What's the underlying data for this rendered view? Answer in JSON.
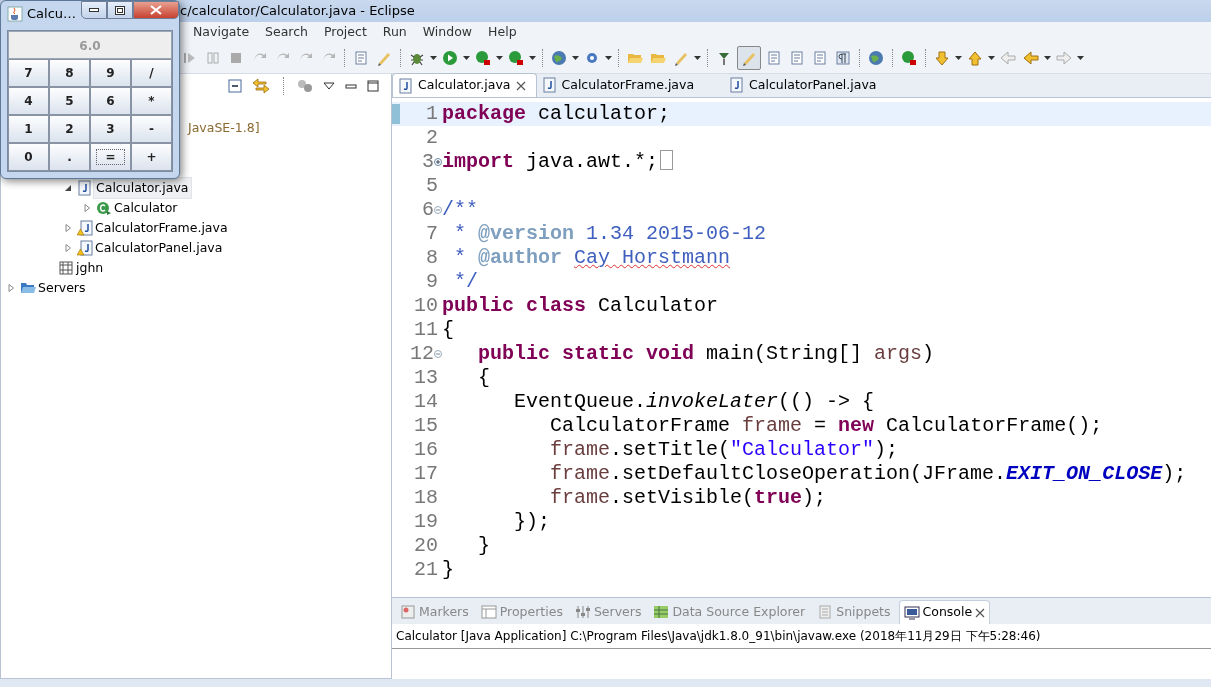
{
  "window": {
    "title": "c/calculator/Calculator.java - Eclipse"
  },
  "menu": [
    "Navigate",
    "Search",
    "Project",
    "Run",
    "Window",
    "Help"
  ],
  "tree": [
    {
      "children": [
        {
          "label": "JavaSE-1.8]",
          "kind": "library-tail"
        },
        {
          "children": [
            {
              "children": [
                {
                  "label": "Calculator.java",
                  "kind": "java",
                  "expanded": true,
                  "selected": true,
                  "children": [
                    {
                      "label": "Calculator",
                      "kind": "class",
                      "expanded": false,
                      "selected": false
                    }
                  ]
                },
                {
                  "label": "CalculatorFrame.java",
                  "kind": "java-warning",
                  "expanded": false,
                  "selected": false
                },
                {
                  "label": "CalculatorPanel.java",
                  "kind": "java-warning",
                  "expanded": false,
                  "selected": false
                }
              ]
            },
            {
              "label": "jghn",
              "kind": "package",
              "selected": false
            }
          ]
        }
      ]
    },
    {
      "label": "Servers",
      "kind": "folder",
      "expanded": false,
      "selected": false
    }
  ],
  "editor_tabs": [
    {
      "label": "Calculator.java",
      "selected": true
    },
    {
      "label": "CalculatorFrame.java",
      "selected": false
    },
    {
      "label": "CalculatorPanel.java",
      "selected": false
    }
  ],
  "code": [
    {
      "number": "1",
      "current": true,
      "tokens": [
        {
          "kind": "keyword",
          "text": "package"
        },
        {
          "kind": "plain",
          "text": " calculator;"
        }
      ]
    },
    {
      "number": "2"
    },
    {
      "number": "3",
      "folded": true,
      "folded_marker": true,
      "tokens": [
        {
          "kind": "keyword",
          "text": "import"
        },
        {
          "kind": "plain",
          "text": " java.awt.*;"
        }
      ]
    },
    {
      "number": "5"
    },
    {
      "number": "6",
      "folded": false,
      "tokens": [
        {
          "kind": "doc",
          "text": "/**"
        }
      ]
    },
    {
      "number": "7",
      "tokens": [
        {
          "kind": "doc",
          "text": " * "
        },
        {
          "kind": "doctag",
          "text": "@version"
        },
        {
          "kind": "doc",
          "text": " 1.34 2015-06-12"
        }
      ]
    },
    {
      "number": "8",
      "tokens": [
        {
          "kind": "doc",
          "text": " * "
        },
        {
          "kind": "doctag",
          "text": "@author "
        },
        {
          "kind": "doc-misspelled",
          "text": "Cay Horstmann"
        }
      ]
    },
    {
      "number": "9",
      "tokens": [
        {
          "kind": "doc",
          "text": " */"
        }
      ]
    },
    {
      "number": "10",
      "tokens": [
        {
          "kind": "keyword",
          "text": "public class"
        },
        {
          "kind": "plain",
          "text": " Calculator"
        }
      ]
    },
    {
      "number": "11",
      "tokens": [
        {
          "kind": "plain",
          "text": "{"
        }
      ]
    },
    {
      "number": "12",
      "folded": false,
      "tokens": [
        {
          "kind": "keyword",
          "text": "   public static void"
        },
        {
          "kind": "plain",
          "text": " main(String[] "
        },
        {
          "kind": "variable",
          "text": "args"
        },
        {
          "kind": "plain",
          "text": ")"
        }
      ]
    },
    {
      "number": "13",
      "tokens": [
        {
          "kind": "plain",
          "text": "   {"
        }
      ]
    },
    {
      "number": "14",
      "tokens": [
        {
          "kind": "plain",
          "text": "      EventQueue."
        },
        {
          "kind": "static-method",
          "text": "invokeLater"
        },
        {
          "kind": "plain",
          "text": "(() -> {"
        }
      ]
    },
    {
      "number": "15",
      "tokens": [
        {
          "kind": "plain",
          "text": "         CalculatorFrame "
        },
        {
          "kind": "variable",
          "text": "frame"
        },
        {
          "kind": "plain",
          "text": " = "
        },
        {
          "kind": "keyword",
          "text": "new"
        },
        {
          "kind": "plain",
          "text": " CalculatorFrame();"
        }
      ]
    },
    {
      "number": "16",
      "tokens": [
        {
          "kind": "variable",
          "text": "         frame"
        },
        {
          "kind": "plain",
          "text": ".setTitle("
        },
        {
          "kind": "string",
          "text": "\"Calculator\""
        },
        {
          "kind": "plain",
          "text": ");"
        }
      ]
    },
    {
      "number": "17",
      "tokens": [
        {
          "kind": "variable",
          "text": "         frame"
        },
        {
          "kind": "plain",
          "text": ".setDefaultCloseOperation(JFrame."
        },
        {
          "kind": "static-field",
          "text": "EXIT_ON_CLOSE"
        },
        {
          "kind": "plain",
          "text": ");"
        }
      ]
    },
    {
      "number": "18",
      "tokens": [
        {
          "kind": "variable",
          "text": "         frame"
        },
        {
          "kind": "plain",
          "text": ".setVisible("
        },
        {
          "kind": "keyword",
          "text": "true"
        },
        {
          "kind": "plain",
          "text": ");"
        }
      ]
    },
    {
      "number": "19",
      "tokens": [
        {
          "kind": "plain",
          "text": "      });"
        }
      ]
    },
    {
      "number": "20",
      "tokens": [
        {
          "kind": "plain",
          "text": "   }"
        }
      ]
    },
    {
      "number": "21",
      "tokens": [
        {
          "kind": "plain",
          "text": "}"
        }
      ]
    }
  ],
  "bottom_tabs": [
    {
      "label": "Markers",
      "selected": false
    },
    {
      "label": "Properties",
      "selected": false
    },
    {
      "label": "Servers",
      "selected": false
    },
    {
      "label": "Data Source Explorer",
      "selected": false
    },
    {
      "label": "Snippets",
      "selected": false
    },
    {
      "label": "Console",
      "selected": true
    }
  ],
  "console": {
    "header": "Calculator [Java Application] C:\\Program Files\\Java\\jdk1.8.0_91\\bin\\javaw.exe (2018年11月29日 下午5:28:46)"
  },
  "calculator": {
    "title": "Calcu…",
    "display": {
      "value": "6.0",
      "disabled": true
    },
    "keys": [
      {
        "label": "7",
        "focused": false
      },
      {
        "label": "8",
        "focused": false
      },
      {
        "label": "9",
        "focused": false
      },
      {
        "label": "/",
        "focused": false
      },
      {
        "label": "4",
        "focused": false
      },
      {
        "label": "5",
        "focused": false
      },
      {
        "label": "6",
        "focused": false
      },
      {
        "label": "*",
        "focused": false
      },
      {
        "label": "1",
        "focused": false
      },
      {
        "label": "2",
        "focused": false
      },
      {
        "label": "3",
        "focused": false
      },
      {
        "label": "-",
        "focused": false
      },
      {
        "label": "0",
        "focused": false
      },
      {
        "label": ".",
        "focused": false
      },
      {
        "label": "=",
        "focused": true
      },
      {
        "label": "+",
        "focused": false
      }
    ]
  }
}
